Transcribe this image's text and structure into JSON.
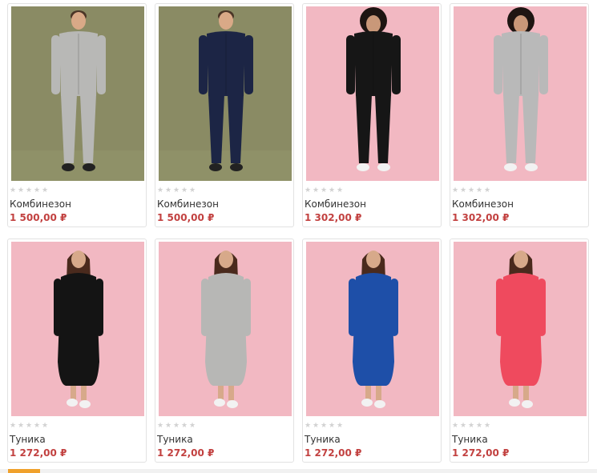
{
  "products": [
    {
      "name": "Комбинезон",
      "price": "1 500,00 ₽",
      "bg": "#8a8b64",
      "floor": "#8f9168",
      "garment": "#b8b8b6",
      "skin": "#d9a987",
      "hair": "#4a3526",
      "shoes": "#222222",
      "figure": "man-jumpsuit-light-icon",
      "rating": 0
    },
    {
      "name": "Комбинезон",
      "price": "1 500,00 ₽",
      "bg": "#8a8b64",
      "floor": "#8f9168",
      "garment": "#1c2545",
      "skin": "#d9a987",
      "hair": "#4a3526",
      "shoes": "#222222",
      "figure": "man-jumpsuit-navy-icon",
      "rating": 0
    },
    {
      "name": "Комбинезон",
      "price": "1 302,00 ₽",
      "bg": "#f2b8c2",
      "floor": "#f2b8c2",
      "garment": "#161616",
      "skin": "#c99879",
      "hair": "#1e1512",
      "shoes": "#f2f2f2",
      "figure": "woman-jumpsuit-black-icon",
      "rating": 0
    },
    {
      "name": "Комбинезон",
      "price": "1 302,00 ₽",
      "bg": "#f2b8c2",
      "floor": "#f2b8c2",
      "garment": "#b9b9b9",
      "skin": "#c99879",
      "hair": "#1e1512",
      "shoes": "#f2f2f2",
      "figure": "woman-jumpsuit-grey-icon",
      "rating": 0
    },
    {
      "name": "Туника",
      "price": "1 272,00 ₽",
      "bg": "#f2b8c2",
      "floor": "#f2b8c2",
      "garment": "#141414",
      "skin": "#d7a98a",
      "hair": "#4a2a1d",
      "shoes": "#f2f2f2",
      "figure": "woman-tunic-black-icon",
      "rating": 0
    },
    {
      "name": "Туника",
      "price": "1 272,00 ₽",
      "bg": "#f2b8c2",
      "floor": "#f2b8c2",
      "garment": "#b7b7b5",
      "skin": "#d7a98a",
      "hair": "#4a2a1d",
      "shoes": "#f2f2f2",
      "figure": "woman-tunic-grey-icon",
      "rating": 0
    },
    {
      "name": "Туника",
      "price": "1 272,00 ₽",
      "bg": "#f2b8c2",
      "floor": "#f2b8c2",
      "garment": "#1e4fa8",
      "skin": "#d7a98a",
      "hair": "#4a2a1d",
      "shoes": "#f2f2f2",
      "figure": "woman-tunic-blue-icon",
      "rating": 0
    },
    {
      "name": "Туника",
      "price": "1 272,00 ₽",
      "bg": "#f2b8c2",
      "floor": "#f2b8c2",
      "garment": "#ef4a5e",
      "skin": "#d7a98a",
      "hair": "#4a2a1d",
      "shoes": "#f2f2f2",
      "figure": "woman-tunic-coral-icon",
      "rating": 0
    }
  ],
  "colors": {
    "price": "#c24140",
    "name": "#333333",
    "star_empty": "#d2d2d2",
    "card_border": "#e2e2e2"
  }
}
